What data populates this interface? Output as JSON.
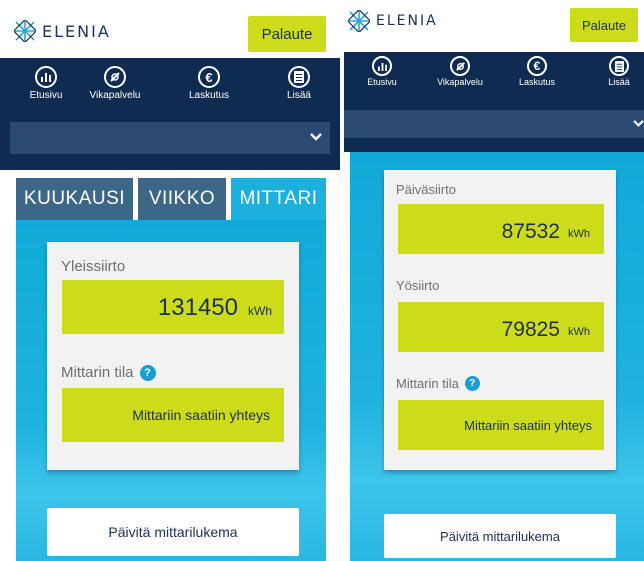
{
  "brand": {
    "name": "ELENIA"
  },
  "header": {
    "feedback_label": "Palaute"
  },
  "nav": {
    "items": [
      {
        "label": "Etusivu",
        "icon": "chart-icon"
      },
      {
        "label": "Vikapalvelu",
        "icon": "no-fault-icon"
      },
      {
        "label": "Laskutus",
        "icon": "euro-icon"
      },
      {
        "label": "Lisää",
        "icon": "menu-list-icon"
      }
    ]
  },
  "tabs": [
    {
      "label": "KUUKAUSI",
      "active": false
    },
    {
      "label": "VIIKKO",
      "active": false
    },
    {
      "label": "MITTARI",
      "active": true
    }
  ],
  "left_screen": {
    "general_transfer": {
      "label": "Yleissiirto",
      "value": "131450",
      "unit": "kWh"
    },
    "meter_status": {
      "label": "Mittarin tila",
      "help": "?",
      "value": "Mittariin saatiin yhteys"
    },
    "update_button": "Päivitä mittarilukema"
  },
  "right_screen": {
    "day_transfer": {
      "label": "Päiväsiirto",
      "value": "87532",
      "unit": "kWh"
    },
    "night_transfer": {
      "label": "Yösiirto",
      "value": "79825",
      "unit": "kWh"
    },
    "meter_status": {
      "label": "Mittarin tila",
      "help": "?",
      "value": "Mittariin saatiin yhteys"
    },
    "update_button": "Päivitä mittarilukema"
  },
  "colors": {
    "navy": "#0f2b52",
    "accent": "#cddc1a",
    "blue": "#1eb0dc",
    "tab_inactive": "#3d6787"
  }
}
